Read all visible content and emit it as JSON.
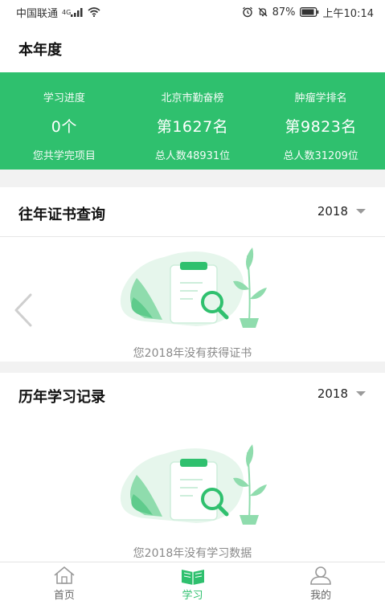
{
  "status_bar": {
    "carrier": "中国联通",
    "network": "4G",
    "battery": "87%",
    "time": "上午10:14",
    "icons": [
      "signal-icon",
      "wifi-icon",
      "alarm-icon",
      "mute-icon",
      "battery-icon"
    ]
  },
  "this_year": {
    "title": "本年度",
    "stats": [
      {
        "label": "学习进度",
        "value": "0个",
        "sub": "您共学完项目"
      },
      {
        "label": "北京市勤奋榜",
        "value": "第1627名",
        "sub": "总人数48931位"
      },
      {
        "label": "肿瘤学排名",
        "value": "第9823名",
        "sub": "总人数31209位"
      }
    ]
  },
  "certificates": {
    "title": "往年证书查询",
    "year": "2018",
    "empty_text": "您2018年没有获得证书"
  },
  "records": {
    "title": "历年学习记录",
    "year": "2018",
    "empty_text": "您2018年没有学习数据"
  },
  "tabbar": {
    "tabs": [
      {
        "label": "首页",
        "icon": "home-icon"
      },
      {
        "label": "学习",
        "icon": "book-icon"
      },
      {
        "label": "我的",
        "icon": "user-icon"
      }
    ],
    "active": "学习"
  },
  "colors": {
    "accent": "#2fc06e",
    "illustration_light": "#e6f6ec",
    "illustration_mid": "#8fdcad"
  }
}
